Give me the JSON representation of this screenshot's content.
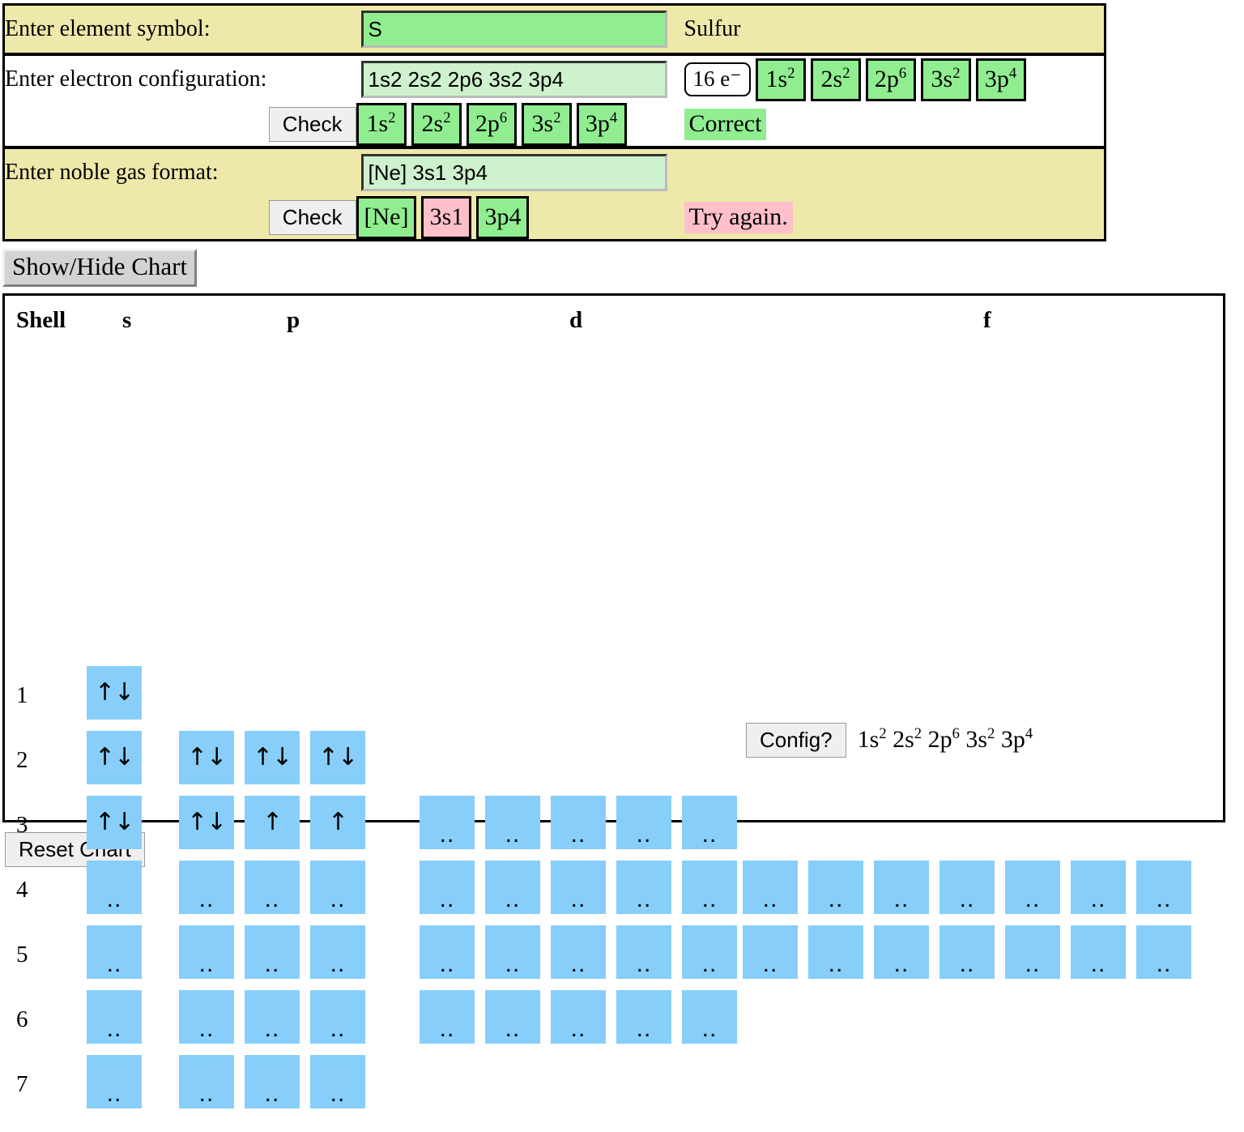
{
  "form": {
    "symbol_row": {
      "label": "Enter element symbol:",
      "input_value": "S",
      "input_placeholder": "",
      "element_name": "Sulfur"
    },
    "config_row": {
      "label": "Enter electron configuration:",
      "input_value": "1s2 2s2 2p6 3s2 3p4",
      "input_placeholder": "",
      "electron_count": "16 e⁻",
      "reference_chips": [
        {
          "base": "1s",
          "exp": "2"
        },
        {
          "base": "2s",
          "exp": "2"
        },
        {
          "base": "2p",
          "exp": "6"
        },
        {
          "base": "3s",
          "exp": "2"
        },
        {
          "base": "3p",
          "exp": "4"
        }
      ]
    },
    "config_check_row": {
      "check_label": "Check",
      "result_chips": [
        {
          "base": "1s",
          "exp": "2",
          "status": "ok"
        },
        {
          "base": "2s",
          "exp": "2",
          "status": "ok"
        },
        {
          "base": "2p",
          "exp": "6",
          "status": "ok"
        },
        {
          "base": "3s",
          "exp": "2",
          "status": "ok"
        },
        {
          "base": "3p",
          "exp": "4",
          "status": "ok"
        }
      ],
      "verdict": "Correct",
      "verdict_status": "ok"
    },
    "noble_row": {
      "label": "Enter noble gas format:",
      "input_value": "[Ne] 3s1 3p4",
      "input_placeholder": ""
    },
    "noble_check_row": {
      "check_label": "Check",
      "result_chips": [
        {
          "base": "[Ne]",
          "exp": "",
          "status": "ok"
        },
        {
          "base": "3s1",
          "exp": "",
          "status": "bad"
        },
        {
          "base": "3p4",
          "exp": "",
          "status": "ok"
        }
      ],
      "verdict": "Try again.",
      "verdict_status": "no"
    }
  },
  "toggle_chart_label": "Show/Hide Chart",
  "reset_chart_label": "Reset Chart",
  "chart": {
    "header": {
      "shell": "Shell",
      "s": "s",
      "p": "p",
      "d": "d",
      "f": "f"
    },
    "config_button_label": "Config?",
    "config_display": [
      {
        "base": "1s",
        "exp": "2"
      },
      {
        "base": "2s",
        "exp": "2"
      },
      {
        "base": "2p",
        "exp": "6"
      },
      {
        "base": "3s",
        "exp": "2"
      },
      {
        "base": "3p",
        "exp": "4"
      }
    ],
    "empty_glyph": "..",
    "pair_glyph": "↑↓",
    "single_glyph": "↑",
    "cell_color": "#87CEFA",
    "shell_labels": [
      "1",
      "2",
      "3",
      "4",
      "5",
      "6",
      "7"
    ],
    "rows": [
      {
        "shell": "1",
        "s": [
          "pair"
        ],
        "p": [],
        "d": [],
        "f": []
      },
      {
        "shell": "2",
        "s": [
          "pair"
        ],
        "p": [
          "pair",
          "pair",
          "pair"
        ],
        "d": [],
        "f": []
      },
      {
        "shell": "3",
        "s": [
          "pair"
        ],
        "p": [
          "pair",
          "single",
          "single"
        ],
        "d": [
          "empty",
          "empty",
          "empty",
          "empty",
          "empty"
        ],
        "f": []
      },
      {
        "shell": "4",
        "s": [
          "empty"
        ],
        "p": [
          "empty",
          "empty",
          "empty"
        ],
        "d": [
          "empty",
          "empty",
          "empty",
          "empty",
          "empty"
        ],
        "f": [
          "empty",
          "empty",
          "empty",
          "empty",
          "empty",
          "empty",
          "empty"
        ]
      },
      {
        "shell": "5",
        "s": [
          "empty"
        ],
        "p": [
          "empty",
          "empty",
          "empty"
        ],
        "d": [
          "empty",
          "empty",
          "empty",
          "empty",
          "empty"
        ],
        "f": [
          "empty",
          "empty",
          "empty",
          "empty",
          "empty",
          "empty",
          "empty"
        ]
      },
      {
        "shell": "6",
        "s": [
          "empty"
        ],
        "p": [
          "empty",
          "empty",
          "empty"
        ],
        "d": [
          "empty",
          "empty",
          "empty",
          "empty",
          "empty"
        ],
        "f": []
      },
      {
        "shell": "7",
        "s": [
          "empty"
        ],
        "p": [
          "empty",
          "empty",
          "empty"
        ],
        "d": [],
        "f": []
      }
    ]
  },
  "colors": {
    "row_background": "#EEE8AA",
    "correct_green": "#90EE90",
    "input_green": "#CDF2CD",
    "error_pink": "#FFC0CB",
    "orbital_blue": "#87CEFA"
  }
}
